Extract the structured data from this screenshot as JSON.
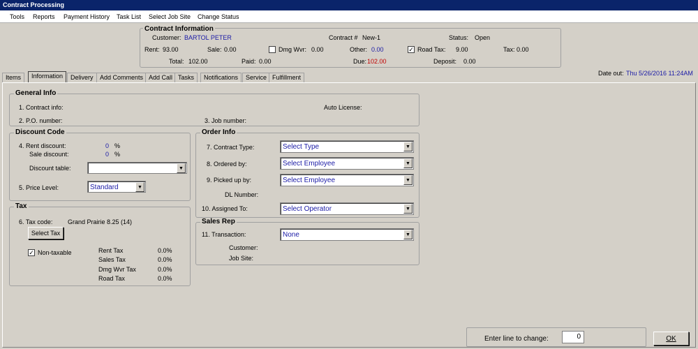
{
  "window": {
    "title": "Contract Processing"
  },
  "menu": [
    "Tools",
    "Reports",
    "Payment History",
    "Task List",
    "Select Job Site",
    "Change Status"
  ],
  "contract_info": {
    "title": "Contract Information",
    "customer_label": "Customer:",
    "customer_value": "BARTOL PETER",
    "contract_label": "Contract #",
    "contract_value": "New-1",
    "status_label": "Status:",
    "status_value": "Open",
    "rent_label": "Rent:",
    "rent_value": "93.00",
    "sale_label": "Sale:",
    "sale_value": "0.00",
    "dmg_label": "Dmg Wvr:",
    "dmg_value": "0.00",
    "dmg_checked": false,
    "other_label": "Other:",
    "other_value": "0.00",
    "roadtax_label": "Road Tax:",
    "roadtax_value": "9.00",
    "roadtax_checked": true,
    "tax_label": "Tax:",
    "tax_value": "0.00",
    "total_label": "Total:",
    "total_value": "102.00",
    "paid_label": "Paid:",
    "paid_value": "0.00",
    "due_label": "Due:",
    "due_value": "102.00",
    "deposit_label": "Deposit:",
    "deposit_value": "0.00"
  },
  "tabs": [
    "Items",
    "Information",
    "Delivery",
    "Add Comments",
    "Add Call",
    "Tasks",
    "Notifications",
    "Service",
    "Fulfillment"
  ],
  "active_tab": "Information",
  "date_out": {
    "label": "Date out:",
    "value": "Thu 5/26/2016 11:24AM"
  },
  "general_info": {
    "title": "General Info",
    "contract_info": "1.  Contract info:",
    "auto_license": "Auto License:",
    "po_number": "2.  P.O. number:",
    "job_number": "3.  Job number:"
  },
  "discount": {
    "title": "Discount Code",
    "rent_label": "4.  Rent discount:",
    "rent_value": "0",
    "sale_label": "Sale discount:",
    "sale_value": "0",
    "percent": "%",
    "table_label": "Discount table:",
    "table_value": "",
    "price_label": "5.  Price Level:",
    "price_value": "Standard"
  },
  "tax": {
    "title": "Tax",
    "code_label": "6.  Tax code:",
    "code_value": "Grand Prairie 8.25 (14)",
    "select_button": "Select Tax",
    "nontaxable_label": "Non-taxable",
    "nontaxable_checked": true,
    "rows": [
      {
        "label": "Rent Tax",
        "value": "0.0%"
      },
      {
        "label": "Sales Tax",
        "value": "0.0%"
      },
      {
        "label": "Dmg Wvr Tax",
        "value": "0.0%"
      },
      {
        "label": "Road Tax",
        "value": "0.0%"
      }
    ]
  },
  "order_info": {
    "title": "Order Info",
    "contract_type_label": "7.  Contract Type:",
    "contract_type_value": "Select Type",
    "ordered_by_label": "8.  Ordered by:",
    "ordered_by_value": "Select Employee",
    "picked_up_label": "9.  Picked up by:",
    "picked_up_value": "Select Employee",
    "dl_label": "DL Number:",
    "assigned_label": "10.  Assigned To:",
    "assigned_value": "Select Operator"
  },
  "sales_rep": {
    "title": "Sales Rep",
    "transaction_label": "11.  Transaction:",
    "transaction_value": "None",
    "customer_label": "Customer:",
    "jobsite_label": "Job Site:"
  },
  "footer": {
    "enter_line_label": "Enter line to change:",
    "enter_line_value": "0",
    "ok_button": "OK"
  }
}
